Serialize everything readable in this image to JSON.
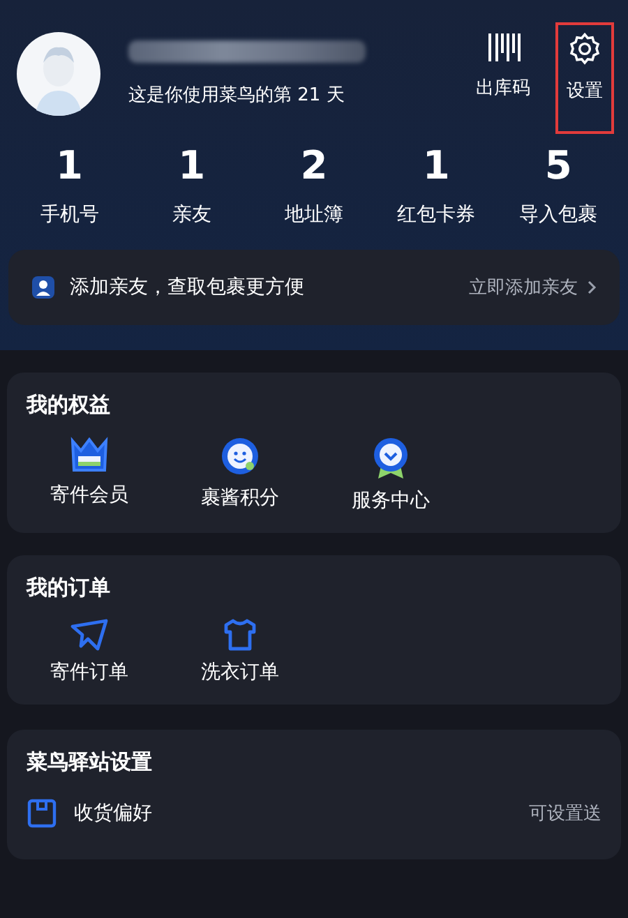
{
  "profile": {
    "subtitle": "这是你使用菜鸟的第 21 天"
  },
  "header_actions": [
    {
      "kind": "barcode",
      "label": "出库码",
      "highlighted": false
    },
    {
      "kind": "settings",
      "label": "设置",
      "highlighted": true
    }
  ],
  "stats": [
    {
      "value": "1",
      "label": "手机号"
    },
    {
      "value": "1",
      "label": "亲友"
    },
    {
      "value": "2",
      "label": "地址簿"
    },
    {
      "value": "1",
      "label": "红包卡券"
    },
    {
      "value": "5",
      "label": "导入包裹"
    }
  ],
  "friend_banner": {
    "text": "添加亲友，查取包裹更方便",
    "link": "立即添加亲友"
  },
  "benefits": {
    "title": "我的权益",
    "items": [
      {
        "kind": "crown",
        "label": "寄件会员"
      },
      {
        "kind": "smile",
        "label": "裹酱积分"
      },
      {
        "kind": "badge",
        "label": "服务中心"
      }
    ]
  },
  "orders": {
    "title": "我的订单",
    "items": [
      {
        "kind": "send",
        "label": "寄件订单"
      },
      {
        "kind": "shirt",
        "label": "洗衣订单"
      }
    ]
  },
  "station": {
    "title": "菜鸟驿站设置",
    "rows": [
      {
        "label": "收货偏好",
        "value": "可设置送"
      }
    ]
  }
}
